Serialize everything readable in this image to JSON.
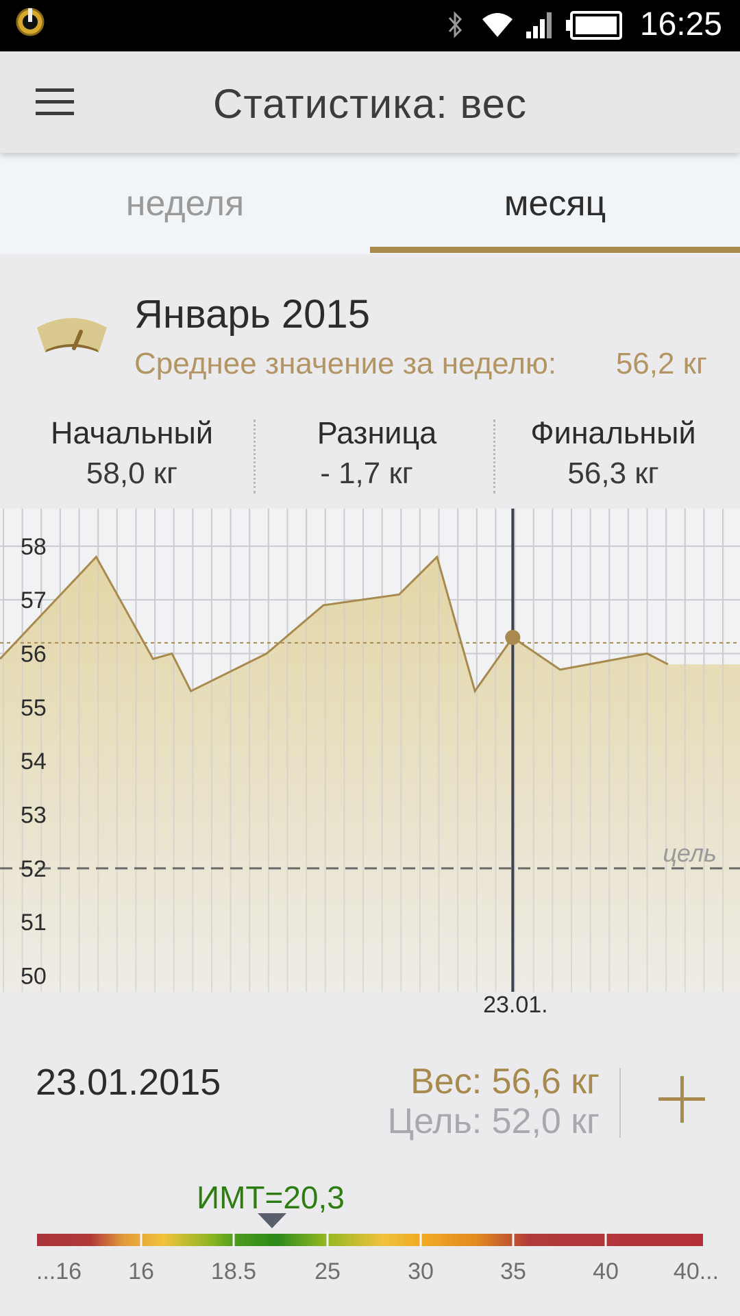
{
  "status_bar": {
    "time": "16:25"
  },
  "app_bar": {
    "title": "Статистика: вес"
  },
  "tabs": [
    {
      "label": "неделя",
      "active": false
    },
    {
      "label": "месяц",
      "active": true
    }
  ],
  "summary": {
    "month": "Январь 2015",
    "average_label": "Среднее значение за неделю:",
    "average_value": "56,2 кг"
  },
  "stats": {
    "start_label": "Начальный",
    "start_value": "58,0 кг",
    "diff_label": "Разница",
    "diff_value": "- 1,7 кг",
    "final_label": "Финальный",
    "final_value": "56,3 кг"
  },
  "chart_data": {
    "type": "area",
    "y_ticks": [
      "58",
      "57",
      "56",
      "55",
      "54",
      "53",
      "52",
      "51",
      "50"
    ],
    "ylim": [
      49.7,
      58.7
    ],
    "x_days": [
      1,
      31
    ],
    "points": [
      [
        1,
        55.9
      ],
      [
        5.9,
        57.8
      ],
      [
        8.9,
        55.9
      ],
      [
        9.9,
        56.0
      ],
      [
        10.9,
        55.3
      ],
      [
        14.9,
        56.0
      ],
      [
        17.9,
        56.9
      ],
      [
        21.9,
        57.1
      ],
      [
        23.9,
        57.8
      ],
      [
        25.9,
        55.3
      ],
      [
        27.9,
        56.3
      ],
      [
        30.4,
        55.7
      ],
      [
        35,
        56.0
      ],
      [
        36.1,
        55.8
      ]
    ],
    "average": 56.2,
    "goal": 52.0,
    "goal_label": "цель",
    "selected_day": 27.9,
    "selected_label": "23.01."
  },
  "detail": {
    "date": "23.01.2015",
    "weight": "Вес: 56,6 кг",
    "goal": "Цель: 52,0 кг"
  },
  "bmi": {
    "label": "ИМТ=20,3",
    "value": 20.3,
    "ticks": [
      "...16",
      "16",
      "18.5",
      "25",
      "30",
      "35",
      "40",
      "40..."
    ]
  },
  "colors": {
    "accent": "#a88a4f",
    "area_fill": "#e6dcb2",
    "bmi_green": "#2e7d12"
  }
}
